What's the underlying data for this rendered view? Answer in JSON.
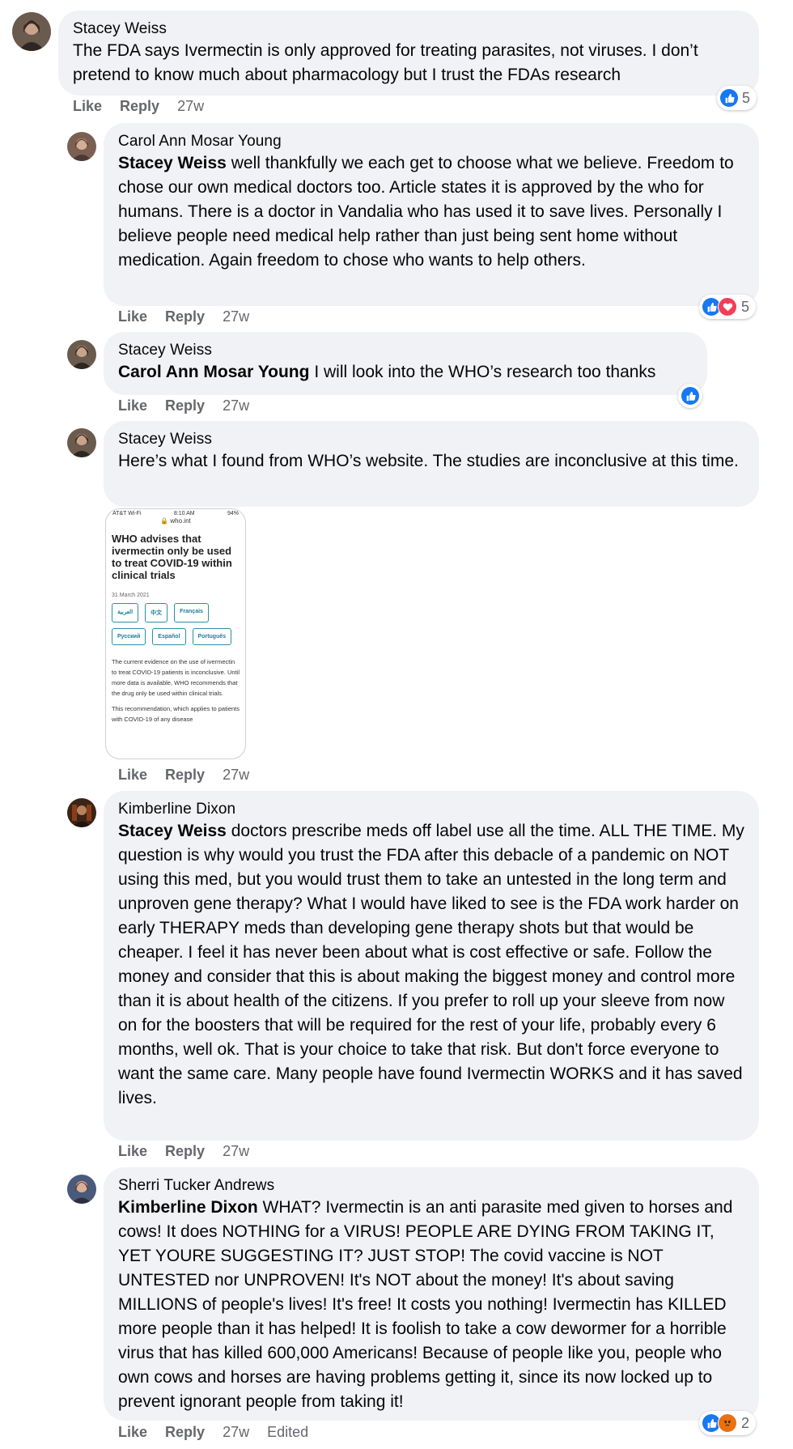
{
  "comments": [
    {
      "author": "Stacey Weiss",
      "mention": "",
      "text": "The FDA says Ivermectin is only approved for treating parasites, not viruses. I don’t pretend to know much about pharmacology but I trust the FDAs research",
      "actions": {
        "like": "Like",
        "reply": "Reply",
        "time": "27w",
        "edited": ""
      },
      "reactions": {
        "icons": [
          "like"
        ],
        "count": "5"
      }
    },
    {
      "author": "Carol Ann Mosar Young",
      "mention": "Stacey Weiss",
      "text": "well thankfully we each get to choose what we believe. Freedom to chose our own medical doctors too. Article states it is approved by the who for humans. There is a doctor in Vandalia who has used it to save lives. Personally I believe people need medical help rather than just being sent home without medication. Again freedom to chose who wants to help others.",
      "actions": {
        "like": "Like",
        "reply": "Reply",
        "time": "27w",
        "edited": ""
      },
      "reactions": {
        "icons": [
          "like",
          "love"
        ],
        "count": "5"
      }
    },
    {
      "author": "Stacey Weiss",
      "mention": "Carol Ann Mosar Young",
      "text": "I will look into the WHO’s research too thanks",
      "actions": {
        "like": "Like",
        "reply": "Reply",
        "time": "27w",
        "edited": ""
      },
      "reactions": {
        "icons": [
          "like"
        ],
        "count": ""
      }
    },
    {
      "author": "Stacey Weiss",
      "mention": "",
      "text": "Here’s what I found from WHO’s website. The studies are inconclusive at this time.",
      "actions": {
        "like": "Like",
        "reply": "Reply",
        "time": "27w",
        "edited": ""
      },
      "attachment": {
        "status_left": "AT&T Wi-Fi",
        "status_time": "8:10 AM",
        "status_right": "94%",
        "url": "who.int",
        "headline": "WHO advises that ivermectin only be used to treat COVID-19 within clinical trials",
        "date": "31 March 2021",
        "languages": [
          "العربية",
          "中文",
          "Français",
          "Русский",
          "Español",
          "Português"
        ],
        "body": "The current evidence on the use of ivermectin to treat COVID-19 patients is inconclusive. Until more data is available, WHO recommends that the drug only be used within clinical trials.",
        "body2": "This recommendation, which applies to patients with COVID-19 of any disease"
      }
    },
    {
      "author": "Kimberline Dixon",
      "mention": "Stacey Weiss",
      "text": "doctors prescribe meds off label use all the time. ALL THE TIME. My question is why would you trust the FDA after this debacle of a pandemic on NOT using this med, but you would trust them to take an untested in the long term and unproven gene therapy? What I would have liked to see is the FDA work harder on early THERAPY meds than developing gene therapy shots but that would be cheaper. I feel it has never been about what is cost effective or safe. Follow the money and consider that this is about making the biggest money and control more than it is about health of the citizens. If you prefer to roll up your sleeve from now on for the boosters that will be required for the rest of your life, probably every 6 months, well ok. That is your choice to take that risk. But don't force everyone to want the same care. Many people have found Ivermectin WORKS and it has saved lives.",
      "actions": {
        "like": "Like",
        "reply": "Reply",
        "time": "27w",
        "edited": ""
      }
    },
    {
      "author": "Sherri Tucker Andrews",
      "mention": "Kimberline Dixon",
      "text": "WHAT? Ivermectin is an anti parasite med given to horses and cows! It does NOTHING for a VIRUS! PEOPLE ARE DYING FROM TAKING IT, YET YOURE SUGGESTING IT? JUST STOP! The covid vaccine is NOT UNTESTED nor UNPROVEN! It's NOT about the money! It's about saving MILLIONS of people's lives! It's free! It costs you nothing! Ivermectin has KILLED more people than it has helped! It is foolish to take a cow dewormer for a horrible virus that has killed 600,000 Americans! Because of people like you, people who own cows and horses are having problems getting it, since its now locked up to prevent ignorant people from taking it!",
      "actions": {
        "like": "Like",
        "reply": "Reply",
        "time": "27w",
        "edited": "Edited"
      },
      "reactions": {
        "icons": [
          "like",
          "angry"
        ],
        "count": "2"
      }
    }
  ],
  "colors": {
    "bubble": "#f0f2f5",
    "meta": "#65676b",
    "like": "#1877f2",
    "love": "#f33e58",
    "angry": "#e9710f"
  }
}
